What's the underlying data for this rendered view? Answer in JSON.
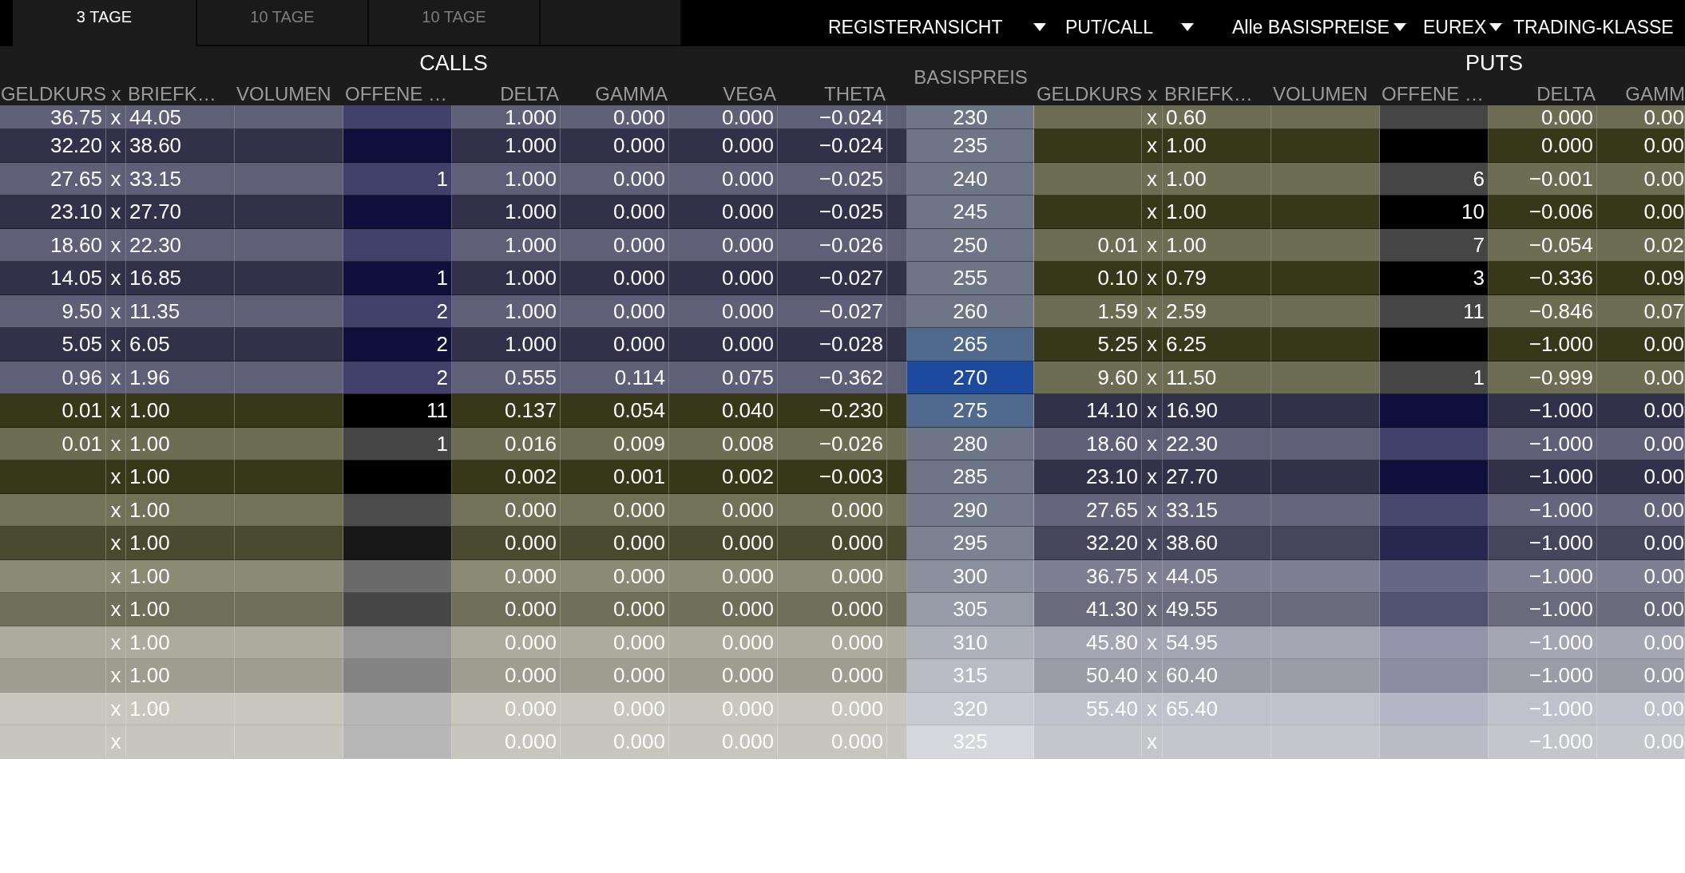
{
  "tabs": [
    {
      "label": "3 TAGE",
      "selected": true
    },
    {
      "label": "10 TAGE",
      "selected": false
    },
    {
      "label": "10 TAGE",
      "selected": false
    }
  ],
  "toolbar": {
    "menus": [
      {
        "label": "REGISTERANSICHT",
        "caret": true
      },
      {
        "label": "PUT/CALL",
        "caret": true
      },
      {
        "label": "Alle BASISPREISE",
        "caret": true
      },
      {
        "label": "EUREX",
        "caret": true
      },
      {
        "label": "TRADING-KLASSE",
        "caret": false
      }
    ]
  },
  "table": {
    "calls": {
      "title": "CALLS",
      "columns": [
        {
          "label": "GELDKURS"
        },
        {
          "label": "x"
        },
        {
          "label": "BRIEFK…"
        },
        {
          "label": "VOLUMEN"
        },
        {
          "label": "OFFENE …"
        },
        {
          "label": "DELTA"
        },
        {
          "label": "GAMMA"
        },
        {
          "label": "VEGA"
        },
        {
          "label": "THETA"
        }
      ]
    },
    "strike_column": {
      "label": "BASISPREIS"
    },
    "puts": {
      "title": "PUTS",
      "columns": [
        {
          "label": "GELDKURS"
        },
        {
          "label": "x"
        },
        {
          "label": "BRIEFK…"
        },
        {
          "label": "VOLUMEN"
        },
        {
          "label": "OFFENE …"
        },
        {
          "label": "DELTA"
        },
        {
          "label": "GAMM"
        }
      ]
    },
    "rows": [
      {
        "call": {
          "in_the_money": true,
          "bid": "36.75",
          "sep": "x",
          "ask": "44.05",
          "delta": "1.000",
          "gamma": "0.000",
          "vega": "0.000",
          "theta": "−0.024"
        },
        "strike": "230",
        "at_the_money": false,
        "near_the_money": false,
        "put": {
          "in_the_money": false,
          "sep": "x",
          "ask": "0.60",
          "delta": "0.000",
          "gamma": "0.00"
        }
      },
      {
        "call": {
          "in_the_money": true,
          "bid": "32.20",
          "sep": "x",
          "ask": "38.60",
          "delta": "1.000",
          "gamma": "0.000",
          "vega": "0.000",
          "theta": "−0.024"
        },
        "strike": "235",
        "at_the_money": false,
        "near_the_money": false,
        "put": {
          "in_the_money": false,
          "sep": "x",
          "ask": "1.00",
          "delta": "0.000",
          "gamma": "0.00"
        }
      },
      {
        "call": {
          "in_the_money": true,
          "bid": "27.65",
          "sep": "x",
          "ask": "33.15",
          "open_interest": "1",
          "delta": "1.000",
          "gamma": "0.000",
          "vega": "0.000",
          "theta": "−0.025"
        },
        "strike": "240",
        "at_the_money": false,
        "near_the_money": false,
        "put": {
          "in_the_money": false,
          "sep": "x",
          "ask": "1.00",
          "open_interest": "6",
          "delta": "−0.001",
          "gamma": "0.00"
        }
      },
      {
        "call": {
          "in_the_money": true,
          "bid": "23.10",
          "sep": "x",
          "ask": "27.70",
          "delta": "1.000",
          "gamma": "0.000",
          "vega": "0.000",
          "theta": "−0.025"
        },
        "strike": "245",
        "at_the_money": false,
        "near_the_money": false,
        "put": {
          "in_the_money": false,
          "sep": "x",
          "ask": "1.00",
          "open_interest": "10",
          "delta": "−0.006",
          "gamma": "0.00"
        }
      },
      {
        "call": {
          "in_the_money": true,
          "bid": "18.60",
          "sep": "x",
          "ask": "22.30",
          "delta": "1.000",
          "gamma": "0.000",
          "vega": "0.000",
          "theta": "−0.026"
        },
        "strike": "250",
        "at_the_money": false,
        "near_the_money": false,
        "put": {
          "in_the_money": false,
          "bid": "0.01",
          "sep": "x",
          "ask": "1.00",
          "open_interest": "7",
          "delta": "−0.054",
          "gamma": "0.02"
        }
      },
      {
        "call": {
          "in_the_money": true,
          "bid": "14.05",
          "sep": "x",
          "ask": "16.85",
          "open_interest": "1",
          "delta": "1.000",
          "gamma": "0.000",
          "vega": "0.000",
          "theta": "−0.027"
        },
        "strike": "255",
        "at_the_money": false,
        "near_the_money": false,
        "put": {
          "in_the_money": false,
          "bid": "0.10",
          "sep": "x",
          "ask": "0.79",
          "open_interest": "3",
          "delta": "−0.336",
          "gamma": "0.09"
        }
      },
      {
        "call": {
          "in_the_money": true,
          "bid": "9.50",
          "sep": "x",
          "ask": "11.35",
          "open_interest": "2",
          "delta": "1.000",
          "gamma": "0.000",
          "vega": "0.000",
          "theta": "−0.027"
        },
        "strike": "260",
        "at_the_money": false,
        "near_the_money": false,
        "put": {
          "in_the_money": false,
          "bid": "1.59",
          "sep": "x",
          "ask": "2.59",
          "open_interest": "11",
          "delta": "−0.846",
          "gamma": "0.07"
        }
      },
      {
        "call": {
          "in_the_money": true,
          "bid": "5.05",
          "sep": "x",
          "ask": "6.05",
          "open_interest": "2",
          "delta": "1.000",
          "gamma": "0.000",
          "vega": "0.000",
          "theta": "−0.028"
        },
        "strike": "265",
        "at_the_money": false,
        "near_the_money": true,
        "put": {
          "in_the_money": false,
          "bid": "5.25",
          "sep": "x",
          "ask": "6.25",
          "delta": "−1.000",
          "gamma": "0.00"
        }
      },
      {
        "call": {
          "in_the_money": true,
          "bid": "0.96",
          "sep": "x",
          "ask": "1.96",
          "open_interest": "2",
          "delta": "0.555",
          "gamma": "0.114",
          "vega": "0.075",
          "theta": "−0.362"
        },
        "strike": "270",
        "at_the_money": true,
        "near_the_money": false,
        "put": {
          "in_the_money": false,
          "bid": "9.60",
          "sep": "x",
          "ask": "11.50",
          "open_interest": "1",
          "delta": "−0.999",
          "gamma": "0.00"
        }
      },
      {
        "call": {
          "in_the_money": false,
          "bid": "0.01",
          "sep": "x",
          "ask": "1.00",
          "open_interest": "11",
          "delta": "0.137",
          "gamma": "0.054",
          "vega": "0.040",
          "theta": "−0.230"
        },
        "strike": "275",
        "at_the_money": false,
        "near_the_money": true,
        "put": {
          "in_the_money": true,
          "bid": "14.10",
          "sep": "x",
          "ask": "16.90",
          "delta": "−1.000",
          "gamma": "0.00"
        }
      },
      {
        "call": {
          "in_the_money": false,
          "bid": "0.01",
          "sep": "x",
          "ask": "1.00",
          "open_interest": "1",
          "delta": "0.016",
          "gamma": "0.009",
          "vega": "0.008",
          "theta": "−0.026"
        },
        "strike": "280",
        "at_the_money": false,
        "near_the_money": false,
        "put": {
          "in_the_money": true,
          "bid": "18.60",
          "sep": "x",
          "ask": "22.30",
          "delta": "−1.000",
          "gamma": "0.00"
        }
      },
      {
        "call": {
          "in_the_money": false,
          "sep": "x",
          "ask": "1.00",
          "delta": "0.002",
          "gamma": "0.001",
          "vega": "0.002",
          "theta": "−0.003"
        },
        "strike": "285",
        "at_the_money": false,
        "near_the_money": false,
        "put": {
          "in_the_money": true,
          "bid": "23.10",
          "sep": "x",
          "ask": "27.70",
          "delta": "−1.000",
          "gamma": "0.00"
        }
      },
      {
        "call": {
          "in_the_money": false,
          "sep": "x",
          "ask": "1.00",
          "delta": "0.000",
          "gamma": "0.000",
          "vega": "0.000",
          "theta": "0.000"
        },
        "strike": "290",
        "at_the_money": false,
        "near_the_money": false,
        "put": {
          "in_the_money": true,
          "bid": "27.65",
          "sep": "x",
          "ask": "33.15",
          "delta": "−1.000",
          "gamma": "0.00"
        }
      },
      {
        "call": {
          "in_the_money": false,
          "sep": "x",
          "ask": "1.00",
          "delta": "0.000",
          "gamma": "0.000",
          "vega": "0.000",
          "theta": "0.000"
        },
        "strike": "295",
        "at_the_money": false,
        "near_the_money": false,
        "put": {
          "in_the_money": true,
          "bid": "32.20",
          "sep": "x",
          "ask": "38.60",
          "delta": "−1.000",
          "gamma": "0.00"
        }
      },
      {
        "call": {
          "in_the_money": false,
          "sep": "x",
          "ask": "1.00",
          "delta": "0.000",
          "gamma": "0.000",
          "vega": "0.000",
          "theta": "0.000"
        },
        "strike": "300",
        "at_the_money": false,
        "near_the_money": false,
        "put": {
          "in_the_money": true,
          "bid": "36.75",
          "sep": "x",
          "ask": "44.05",
          "delta": "−1.000",
          "gamma": "0.00"
        }
      },
      {
        "call": {
          "in_the_money": false,
          "sep": "x",
          "ask": "1.00",
          "delta": "0.000",
          "gamma": "0.000",
          "vega": "0.000",
          "theta": "0.000"
        },
        "strike": "305",
        "at_the_money": false,
        "near_the_money": false,
        "put": {
          "in_the_money": true,
          "bid": "41.30",
          "sep": "x",
          "ask": "49.55",
          "delta": "−1.000",
          "gamma": "0.00"
        }
      },
      {
        "call": {
          "in_the_money": false,
          "sep": "x",
          "ask": "1.00",
          "delta": "0.000",
          "gamma": "0.000",
          "vega": "0.000",
          "theta": "0.000"
        },
        "strike": "310",
        "at_the_money": false,
        "near_the_money": false,
        "put": {
          "in_the_money": true,
          "bid": "45.80",
          "sep": "x",
          "ask": "54.95",
          "delta": "−1.000",
          "gamma": "0.00"
        }
      },
      {
        "call": {
          "in_the_money": false,
          "sep": "x",
          "ask": "1.00",
          "delta": "0.000",
          "gamma": "0.000",
          "vega": "0.000",
          "theta": "0.000"
        },
        "strike": "315",
        "at_the_money": false,
        "near_the_money": false,
        "put": {
          "in_the_money": true,
          "bid": "50.40",
          "sep": "x",
          "ask": "60.40",
          "delta": "−1.000",
          "gamma": "0.00"
        }
      },
      {
        "call": {
          "in_the_money": false,
          "sep": "x",
          "ask": "1.00",
          "delta": "0.000",
          "gamma": "0.000",
          "vega": "0.000",
          "theta": "0.000"
        },
        "strike": "320",
        "at_the_money": false,
        "near_the_money": false,
        "put": {
          "in_the_money": true,
          "bid": "55.40",
          "sep": "x",
          "ask": "65.40",
          "delta": "−1.000",
          "gamma": "0.00"
        }
      },
      {
        "call": {
          "in_the_money": false,
          "sep": "x",
          "delta": "0.000",
          "gamma": "0.000",
          "vega": "0.000",
          "theta": "0.000"
        },
        "strike": "325",
        "at_the_money": false,
        "near_the_money": false,
        "put": {
          "in_the_money": true,
          "sep": "x",
          "delta": "−1.000",
          "gamma": "0.00"
        }
      }
    ]
  }
}
